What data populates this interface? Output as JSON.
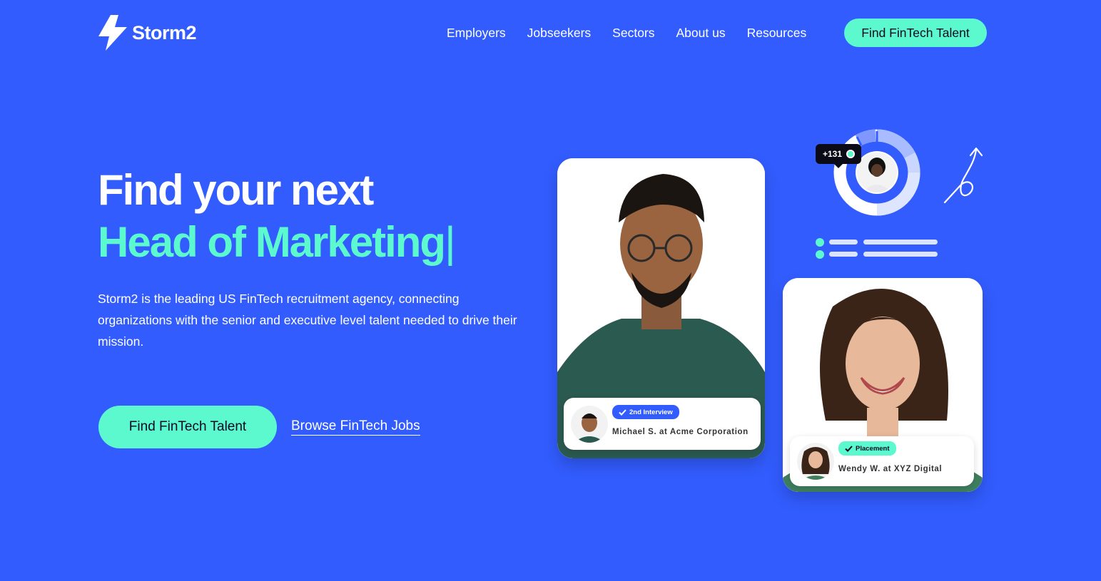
{
  "header": {
    "logo_text": "Storm2",
    "nav": [
      "Employers",
      "Jobseekers",
      "Sectors",
      "About us",
      "Resources"
    ],
    "cta_label": "Find FinTech Talent"
  },
  "hero": {
    "title_line1": "Find your next",
    "title_line2": "Head of Marketing",
    "caret": "|",
    "description": "Storm2 is the leading US FinTech recruitment agency, connecting organizations with the senior and executive level talent needed to drive their mission.",
    "primary_button": "Find FinTech Talent",
    "secondary_link": "Browse FinTech Jobs"
  },
  "cards": {
    "stat_value": "+131",
    "candidate_1": {
      "status": "2nd Interview",
      "name": "Michael S. at Acme Corporation"
    },
    "candidate_2": {
      "status": "Placement",
      "name": "Wendy W. at XYZ Digital"
    }
  },
  "colors": {
    "background": "#325cfe",
    "accent": "#5cf9cf",
    "text_dark": "#0a0a23"
  }
}
